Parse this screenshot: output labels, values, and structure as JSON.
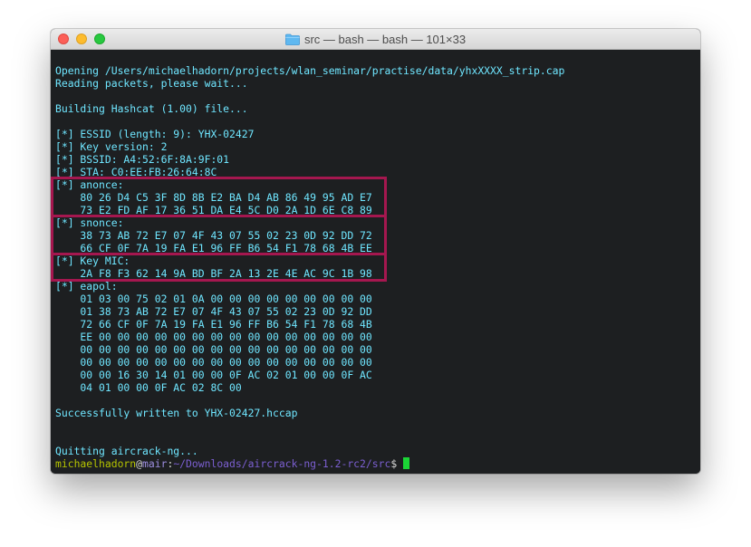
{
  "window": {
    "title": "src — bash — bash — 101×33"
  },
  "colors": {
    "terminal_bg": "#1d1f21",
    "output_text": "#6fe6ff",
    "highlight_box": "#a5174f",
    "prompt_user": "#b5c400",
    "prompt_host": "#9d8ee0",
    "prompt_path": "#7b5fd1",
    "cursor": "#1bd636"
  },
  "terminal": {
    "lines": [
      "Opening /Users/michaelhadorn/projects/wlan_seminar/practise/data/yhxXXXX_strip.cap",
      "Reading packets, please wait...",
      "",
      "Building Hashcat (1.00) file...",
      "",
      "[*] ESSID (length: 9): YHX-02427",
      "[*] Key version: 2",
      "[*] BSSID: A4:52:6F:8A:9F:01",
      "[*] STA: C0:EE:FB:26:64:8C",
      "[*] anonce:",
      "    80 26 D4 C5 3F 8D 8B E2 BA D4 AB 86 49 95 AD E7",
      "    73 E2 FD AF 17 36 51 DA E4 5C D0 2A 1D 6E C8 89",
      "[*] snonce:",
      "    38 73 AB 72 E7 07 4F 43 07 55 02 23 0D 92 DD 72",
      "    66 CF 0F 7A 19 FA E1 96 FF B6 54 F1 78 68 4B EE",
      "[*] Key MIC:",
      "    2A F8 F3 62 14 9A BD BF 2A 13 2E 4E AC 9C 1B 98",
      "[*] eapol:",
      "    01 03 00 75 02 01 0A 00 00 00 00 00 00 00 00 00",
      "    01 38 73 AB 72 E7 07 4F 43 07 55 02 23 0D 92 DD",
      "    72 66 CF 0F 7A 19 FA E1 96 FF B6 54 F1 78 68 4B",
      "    EE 00 00 00 00 00 00 00 00 00 00 00 00 00 00 00",
      "    00 00 00 00 00 00 00 00 00 00 00 00 00 00 00 00",
      "    00 00 00 00 00 00 00 00 00 00 00 00 00 00 00 00",
      "    00 00 16 30 14 01 00 00 0F AC 02 01 00 00 0F AC",
      "    04 01 00 00 0F AC 02 8C 00",
      "",
      "Successfully written to YHX-02427.hccap",
      "",
      "",
      "Quitting aircrack-ng..."
    ],
    "prompt": {
      "user": "michaelhadorn",
      "at": "@",
      "host": "mair",
      "colon": ":",
      "path": "~/Downloads/aircrack-ng-1.2-rc2/src",
      "symbol": "$"
    }
  }
}
